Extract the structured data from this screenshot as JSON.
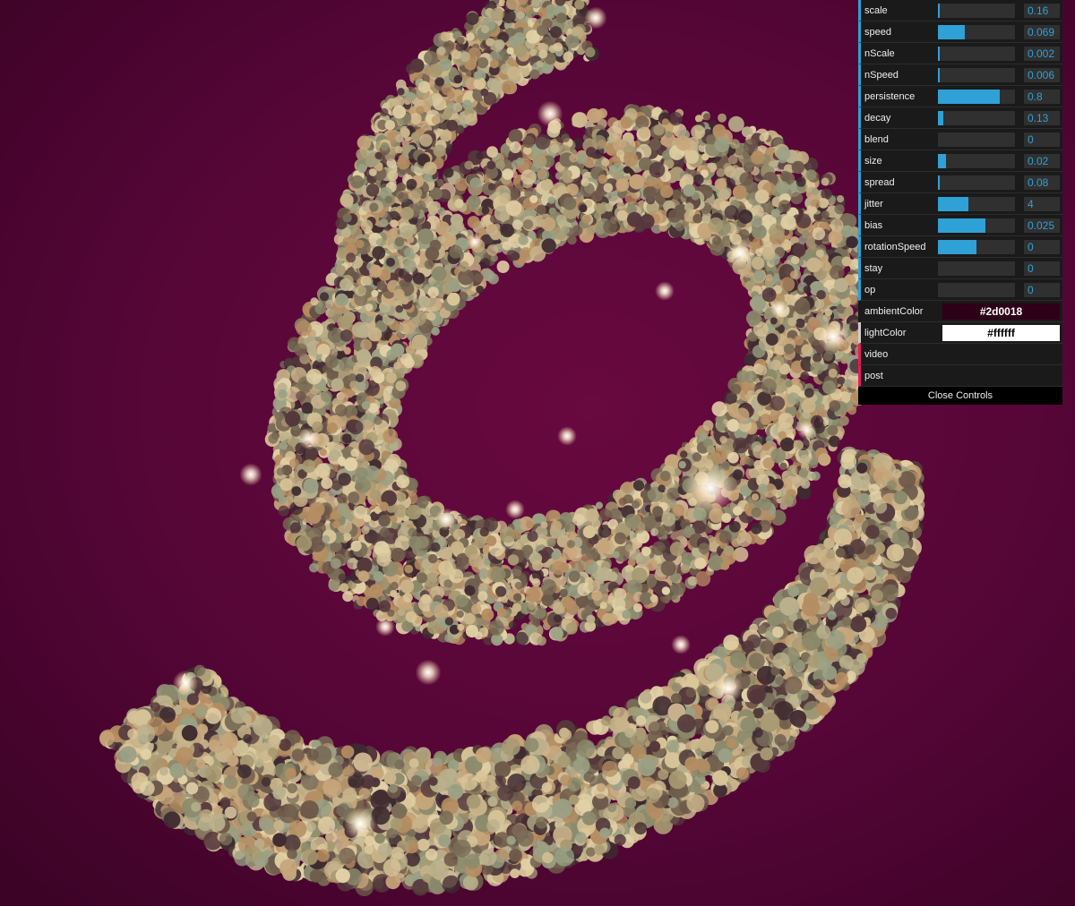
{
  "colors": {
    "background": "#560637",
    "panel_bg": "#1a1a1a",
    "number_accent": "#2fa1d6",
    "folder_accent": "#e61d5f"
  },
  "scene": {
    "subject": "particle-ribbon-swirl"
  },
  "controls": {
    "sliders": [
      {
        "name": "scale",
        "value": "0.16",
        "fill": 0.02
      },
      {
        "name": "speed",
        "value": "0.069",
        "fill": 0.35
      },
      {
        "name": "nScale",
        "value": "0.002",
        "fill": 0.02
      },
      {
        "name": "nSpeed",
        "value": "0.006",
        "fill": 0.02
      },
      {
        "name": "persistence",
        "value": "0.8",
        "fill": 0.8
      },
      {
        "name": "decay",
        "value": "0.13",
        "fill": 0.07
      },
      {
        "name": "blend",
        "value": "0",
        "fill": 0
      },
      {
        "name": "size",
        "value": "0.02",
        "fill": 0.1
      },
      {
        "name": "spread",
        "value": "0.08",
        "fill": 0.02
      },
      {
        "name": "jitter",
        "value": "4",
        "fill": 0.4
      },
      {
        "name": "bias",
        "value": "0.025",
        "fill": 0.62
      },
      {
        "name": "rotationSpeed",
        "value": "0",
        "fill": 0.5
      },
      {
        "name": "stay",
        "value": "0",
        "fill": 0
      },
      {
        "name": "op",
        "value": "0",
        "fill": 0
      }
    ],
    "ambientColor": {
      "label": "ambientColor",
      "value": "#2d0018",
      "text_color": "#ffffff"
    },
    "lightColor": {
      "label": "lightColor",
      "value": "#ffffff",
      "text_color": "#000000"
    },
    "folders": [
      "video",
      "post"
    ],
    "close_label": "Close Controls"
  }
}
